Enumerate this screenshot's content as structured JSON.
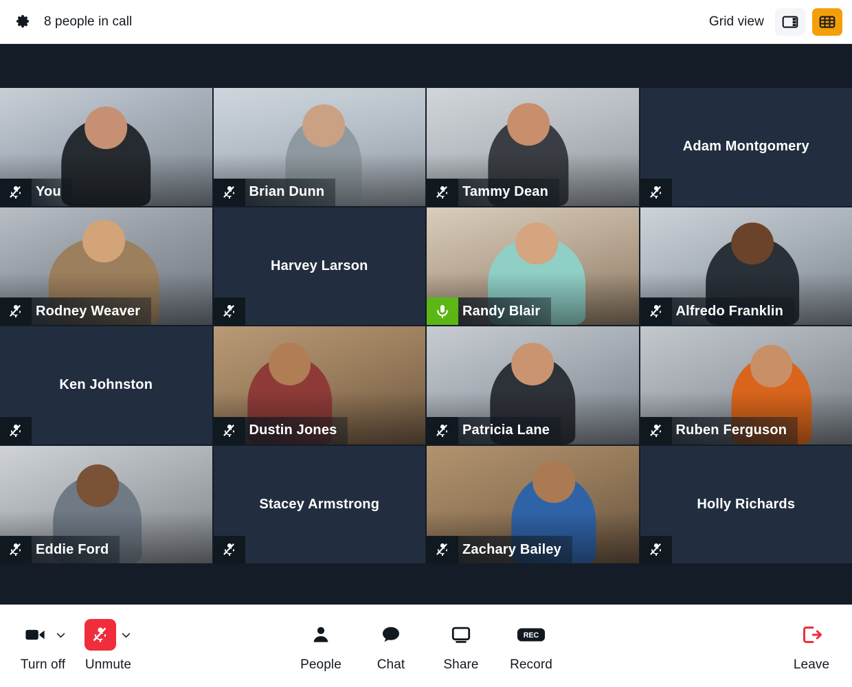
{
  "header": {
    "settings_icon": "gear-icon",
    "title": "8 people in call",
    "view_label": "Grid view",
    "views": [
      {
        "name": "speaker-view",
        "icon": "sidebar-layout-icon",
        "active": false
      },
      {
        "name": "grid-view",
        "icon": "grid-layout-icon",
        "active": true
      }
    ],
    "accent_color": "#F59E0B"
  },
  "grid": {
    "columns": 4,
    "rows": 4,
    "tile_bg": "#222e3f",
    "muted_badge_color": "#101820",
    "active_mic_color": "#5cb615",
    "participants": [
      {
        "name": "You",
        "video": true,
        "muted": true,
        "mic_icon": "mic-muted-icon",
        "scene": "office-woman-headset"
      },
      {
        "name": "Brian Dunn",
        "video": true,
        "muted": true,
        "mic_icon": "mic-muted-icon",
        "scene": "cafe-window-beanie"
      },
      {
        "name": "Tammy Dean",
        "video": true,
        "muted": true,
        "mic_icon": "mic-muted-icon",
        "scene": "open-office-curly"
      },
      {
        "name": "Adam Montgomery",
        "video": false,
        "muted": true,
        "mic_icon": "mic-muted-icon",
        "scene": ""
      },
      {
        "name": "Rodney Weaver",
        "video": true,
        "muted": true,
        "mic_icon": "mic-muted-icon",
        "scene": "office-man-headset"
      },
      {
        "name": "Harvey Larson",
        "video": false,
        "muted": true,
        "mic_icon": "mic-muted-icon",
        "scene": ""
      },
      {
        "name": "Randy Blair",
        "video": true,
        "muted": false,
        "mic_icon": "mic-on-icon",
        "scene": "cafe-man-sweater"
      },
      {
        "name": "Alfredo Franklin",
        "video": true,
        "muted": true,
        "mic_icon": "mic-muted-icon",
        "scene": "loft-man-smiling"
      },
      {
        "name": "Ken Johnston",
        "video": false,
        "muted": true,
        "mic_icon": "mic-muted-icon",
        "scene": ""
      },
      {
        "name": "Dustin Jones",
        "video": true,
        "muted": true,
        "mic_icon": "mic-muted-icon",
        "scene": "library-two-men"
      },
      {
        "name": "Patricia Lane",
        "video": true,
        "muted": true,
        "mic_icon": "mic-muted-icon",
        "scene": "office-woman-headset-2"
      },
      {
        "name": "Ruben Ferguson",
        "video": true,
        "muted": true,
        "mic_icon": "mic-muted-icon",
        "scene": "desk-two-men-orange"
      },
      {
        "name": "Eddie Ford",
        "video": true,
        "muted": true,
        "mic_icon": "mic-muted-icon",
        "scene": "warehouse-man-arms"
      },
      {
        "name": "Stacey Armstrong",
        "video": false,
        "muted": true,
        "mic_icon": "mic-muted-icon",
        "scene": ""
      },
      {
        "name": "Zachary Bailey",
        "video": true,
        "muted": true,
        "mic_icon": "mic-muted-icon",
        "scene": "library-two-men-2"
      },
      {
        "name": "Holly Richards",
        "video": false,
        "muted": true,
        "mic_icon": "mic-muted-icon",
        "scene": ""
      }
    ]
  },
  "toolbar": {
    "camera": {
      "label": "Turn off",
      "icon": "video-camera-icon",
      "state": "on",
      "has_menu": true
    },
    "mic": {
      "label": "Unmute",
      "icon": "mic-muted-icon",
      "state": "muted",
      "has_menu": true,
      "color": "#F02D3A"
    },
    "center": [
      {
        "label": "People",
        "icon": "person-icon"
      },
      {
        "label": "Chat",
        "icon": "speech-bubble-icon"
      },
      {
        "label": "Share",
        "icon": "monitor-icon"
      },
      {
        "label": "Record",
        "icon": "rec-badge-icon"
      }
    ],
    "leave": {
      "label": "Leave",
      "icon": "exit-arrow-icon",
      "color": "#F02D3A"
    }
  }
}
